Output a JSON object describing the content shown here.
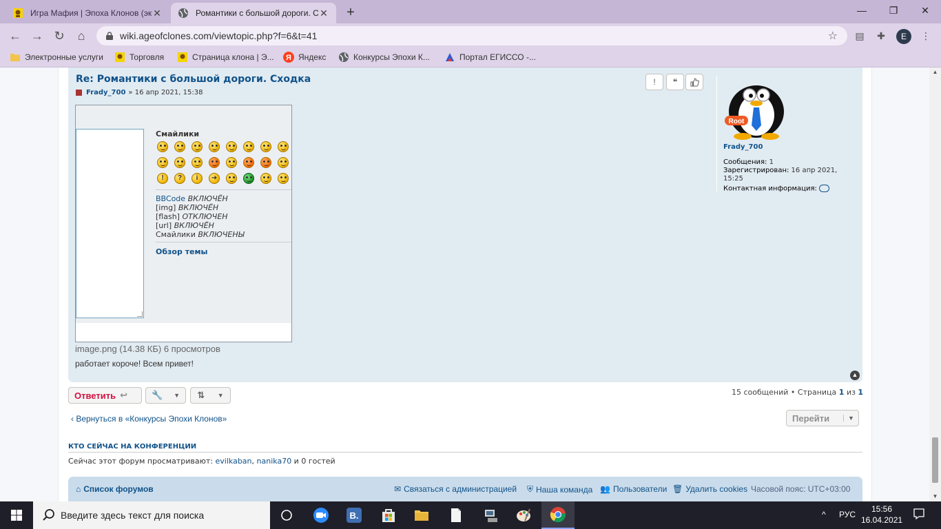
{
  "browser": {
    "tabs": [
      {
        "title": "Игра Мафия | Эпоха Клонов (эк",
        "active": false
      },
      {
        "title": "Романтики с большой дороги. С",
        "active": true
      }
    ],
    "new_tab": "+",
    "window_controls": {
      "minimize": "—",
      "restore": "❐",
      "close": "✕"
    },
    "url": "wiki.ageofclones.com/viewtopic.php?f=6&t=41",
    "profile_initial": "E",
    "bookmarks": [
      {
        "label": "Электронные услуги",
        "icon": "folder-icon"
      },
      {
        "label": "Торговля",
        "icon": "clone-icon"
      },
      {
        "label": "Страница клона | Э...",
        "icon": "clone-icon"
      },
      {
        "label": "Яндекс",
        "icon": "yandex-icon"
      },
      {
        "label": "Конкурсы Эпохи К...",
        "icon": "globe-icon"
      },
      {
        "label": "Портал ЕГИССО -...",
        "icon": "egisso-icon"
      }
    ]
  },
  "post": {
    "title": "Re: Романтики с большой дороги. Сходка",
    "author": "Frady_700",
    "date": "» 16 апр 2021, 15:38",
    "buttons": {
      "report": "!",
      "quote": "❝",
      "like": "👍"
    },
    "attachment": {
      "smileys_title": "Смайлики",
      "bbcode": [
        {
          "name": "BBCode",
          "state": "ВКЛЮЧЁН",
          "link": true
        },
        {
          "name": "[img]",
          "state": "ВКЛЮЧЁН",
          "link": false
        },
        {
          "name": "[flash]",
          "state": "ОТКЛЮЧЕН",
          "link": false
        },
        {
          "name": "[url]",
          "state": "ВКЛЮЧЁН",
          "link": false
        },
        {
          "name": "Смайлики",
          "state": "ВКЛЮЧЕНЫ",
          "link": false
        }
      ],
      "topic_review": "Обзор темы",
      "caption": "image.png (14.38 КБ) 6 просмотров"
    },
    "body": "работает короче! Всем привет!"
  },
  "profile": {
    "avatar_badge": "Root",
    "username": "Frady_700",
    "posts_label": "Сообщения:",
    "posts_value": "1",
    "registered_label": "Зарегистрирован:",
    "registered_value_1": "16 апр 2021,",
    "registered_value_2": "15:25",
    "contact_label": "Контактная информация:"
  },
  "actions": {
    "reply": "Ответить",
    "pagination": {
      "prefix": "15 сообщений • Страница ",
      "current": "1",
      "of": " из ",
      "total": "1"
    },
    "back": "‹  Вернуться в «Конкурсы Эпохи Клонов»",
    "jump": "Перейти"
  },
  "online": {
    "heading": "КТО СЕЙЧАС НА КОНФЕРЕНЦИИ",
    "text": "Сейчас этот форум просматривают: ",
    "users": [
      "evilkaban",
      "nanika70"
    ],
    "sep": ", ",
    "suffix": " и 0 гостей"
  },
  "footer": {
    "forum_list": "Список форумов",
    "contact": "Связаться с администрацией",
    "team": "Наша команда",
    "users": "Пользователи",
    "cookies": "Удалить cookies",
    "timezone": "Часовой пояс: UTC+03:00"
  },
  "taskbar": {
    "search_placeholder": "Введите здесь текст для поиска",
    "tray_language": "РУС",
    "time": "15:56",
    "date": "16.04.2021"
  },
  "colors": {
    "link": "#105289",
    "post_bg": "#e1ebf2",
    "reply": "#d31141",
    "browser_frame": "#c6b6d6"
  }
}
